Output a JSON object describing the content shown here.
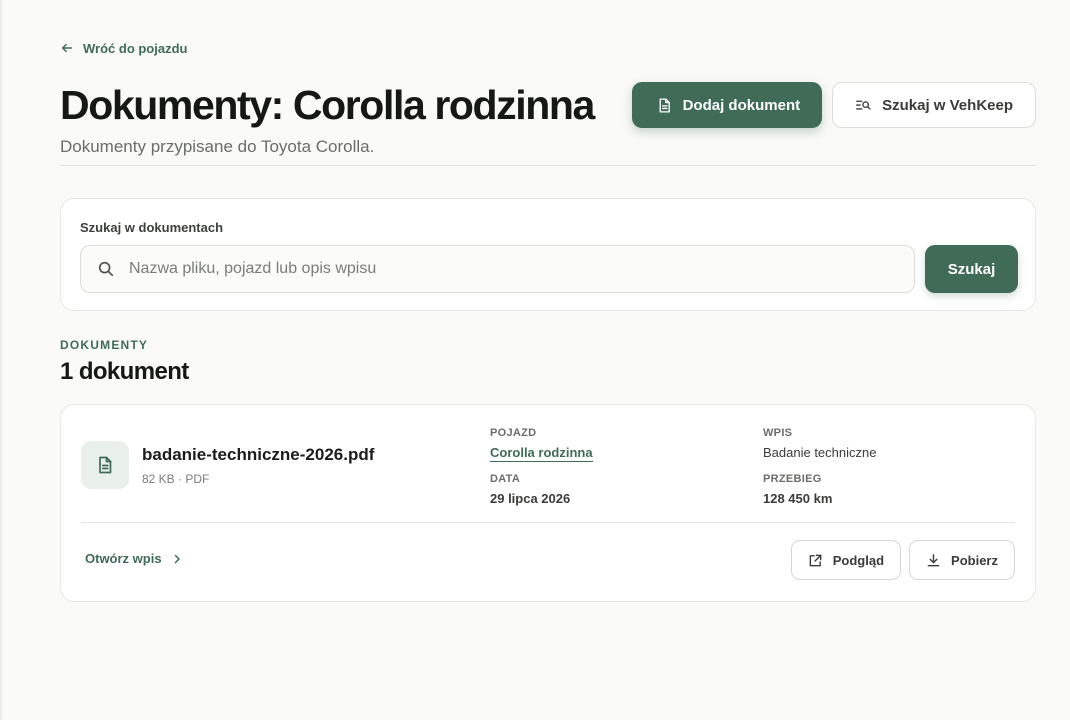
{
  "back_link": {
    "label": "Wróć do pojazdu",
    "icon": "arrow-left-icon"
  },
  "header": {
    "title": "Dokumenty: Corolla rodzinna",
    "subtitle": "Dokumenty przypisane do Toyota Corolla.",
    "add_button": "Dodaj dokument",
    "search_vehkeep_button": "Szukaj w VehKeep"
  },
  "search": {
    "label": "Szukaj w dokumentach",
    "placeholder": "Nazwa pliku, pojazd lub opis wpisu",
    "value": "",
    "button": "Szukaj"
  },
  "documents": {
    "eyebrow": "DOKUMENTY",
    "count_title": "1 dokument",
    "items": [
      {
        "file_name": "badanie-techniczne-2026.pdf",
        "file_meta": "82 KB · PDF",
        "vehicle_label": "POJAZD",
        "vehicle_value": "Corolla rodzinna",
        "entry_label": "WPIS",
        "entry_value": "Badanie techniczne",
        "date_label": "DATA",
        "date_value": "29 lipca 2026",
        "mileage_label": "PRZEBIEG",
        "mileage_value": "128 450 km",
        "open_entry": "Otwórz wpis",
        "preview_button": "Podgląd",
        "download_button": "Pobierz"
      }
    ]
  },
  "colors": {
    "accent": "#3f6b57",
    "accent_soft": "#e9efeb",
    "background": "#fafaf8",
    "card": "#ffffff",
    "border": "#e6e6e2",
    "text": "#1b1d1b",
    "muted": "#6a6d69"
  }
}
